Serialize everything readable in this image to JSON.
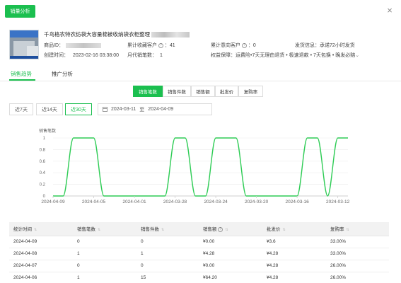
{
  "header": {
    "button_label": "销量分析",
    "close_icon": "close-icon"
  },
  "product": {
    "title": "千鸟格农特农纺袋大容量棉被收纳袋衣柜整理",
    "id_label": "商品ID：",
    "created_label": "创建时间：",
    "created_value": "2023-02-16 03:38:00",
    "cumulative_customers_label": "累计收藏客户",
    "cumulative_customers_value": "：41",
    "monthly_sales_label": "月代销笔数：",
    "monthly_sales_value": "1",
    "cumulative_inquiry_label": "累计意向客户",
    "cumulative_inquiry_value": "：0",
    "rights_label": "权益保障：",
    "rights_value": "运费险•7天无理由退货 • 极速退款 • 7天包换 • 晚发必赔",
    "shipping_label": "发货信息：",
    "shipping_value": "承诺72小时发货"
  },
  "tabs": [
    "销售趋势",
    "推广分析"
  ],
  "metric_tabs": [
    "销售笔数",
    "销售件数",
    "销售额",
    "批发价",
    "复购率"
  ],
  "ranges": [
    "近7天",
    "近14天",
    "近30天"
  ],
  "date_range": {
    "start": "2024-03-11",
    "sep": "至",
    "end": "2024-04-09"
  },
  "chart_data": {
    "type": "line",
    "ylabel": "销售笔数",
    "ylim": [
      0,
      1
    ],
    "yticks": [
      "0",
      "0.2",
      "0.4",
      "0.6",
      "0.8",
      "1"
    ],
    "x": [
      "2024-03-11",
      "2024-03-12",
      "2024-03-13",
      "2024-03-14",
      "2024-03-15",
      "2024-03-16",
      "2024-03-17",
      "2024-03-18",
      "2024-03-19",
      "2024-03-20",
      "2024-03-21",
      "2024-03-22",
      "2024-03-23",
      "2024-03-24",
      "2024-03-25",
      "2024-03-26",
      "2024-03-27",
      "2024-03-28",
      "2024-03-29",
      "2024-03-30",
      "2024-03-31",
      "2024-04-01",
      "2024-04-02",
      "2024-04-03",
      "2024-04-04",
      "2024-04-05",
      "2024-04-06",
      "2024-04-07",
      "2024-04-08",
      "2024-04-09"
    ],
    "xtick_labels": [
      "2024-04-09",
      "2024-04-05",
      "2024-04-01",
      "2024-03-28",
      "2024-03-24",
      "2024-03-20",
      "2024-03-16",
      "2024-03-12"
    ],
    "series": [
      {
        "values": [
          1,
          1,
          0,
          1,
          1,
          0,
          0,
          0,
          0,
          0,
          0,
          1,
          1,
          1,
          0,
          0,
          1,
          1,
          0,
          0,
          0,
          0,
          0,
          0,
          0,
          1,
          1,
          1,
          0,
          0
        ]
      }
    ],
    "colors": {
      "line": "#2ecc55",
      "axis": "#cfcfcf",
      "grid": "#ececec"
    }
  },
  "table": {
    "headers": [
      "统计时间",
      "销售笔数",
      "销售件数",
      "销售额",
      "批发价",
      "复购率"
    ],
    "rows": [
      [
        "2024-04-09",
        "0",
        "0",
        "¥0.00",
        "¥3.6",
        "33.00%"
      ],
      [
        "2024-04-08",
        "1",
        "1",
        "¥4.28",
        "¥4.28",
        "33.00%"
      ],
      [
        "2024-04-07",
        "0",
        "0",
        "¥0.00",
        "¥4.28",
        "26.00%"
      ],
      [
        "2024-04-06",
        "1",
        "15",
        "¥64.20",
        "¥4.28",
        "26.00%"
      ]
    ]
  }
}
